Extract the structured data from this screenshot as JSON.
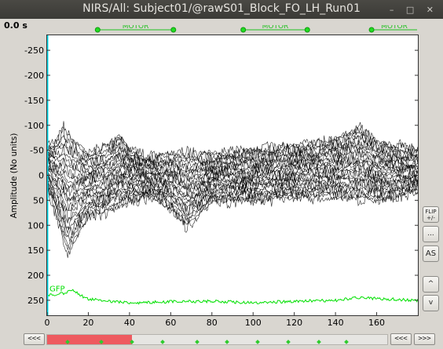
{
  "window": {
    "title": "NIRS/All: Subject01/@rawS01_Block_FO_LH_Run01",
    "min_glyph": "–",
    "max_glyph": "□",
    "close_glyph": "✕"
  },
  "time_label": "0.0 s",
  "events": [
    {
      "label": "MOTOR",
      "start": 24.9,
      "end": 61.7
    },
    {
      "label": "MOTOR",
      "start": 95.6,
      "end": 126.7
    },
    {
      "label": "MOTOR",
      "start": 157.9,
      "end": 180
    }
  ],
  "colors": {
    "signal": "#000000",
    "gfp": "#00e000",
    "events": "#20c020",
    "cursor": "#00d8e8",
    "scroll_thumb": "#ee5a5f"
  },
  "chart_data": {
    "type": "line",
    "ylabel": "Amplitude (No units)",
    "xlim": [
      0,
      180
    ],
    "ylim": [
      -280,
      280
    ],
    "y_inverted": true,
    "xticks": [
      "0",
      "20",
      "40",
      "60",
      "80",
      "100",
      "120",
      "140",
      "160"
    ],
    "yticks": [
      "-250",
      "-200",
      "-150",
      "-100",
      "-50",
      "0",
      "50",
      "100",
      "150",
      "200",
      "250"
    ],
    "series": [
      {
        "name": "GFP",
        "baseline": 248,
        "description_values": [
          [
            0,
            240
          ],
          [
            8,
            236
          ],
          [
            12,
            230
          ],
          [
            20,
            248
          ],
          [
            40,
            255
          ],
          [
            60,
            253
          ],
          [
            80,
            252
          ],
          [
            100,
            255
          ],
          [
            120,
            252
          ],
          [
            140,
            250
          ],
          [
            150,
            245
          ],
          [
            180,
            250
          ]
        ]
      }
    ],
    "envelope_top": [
      [
        0,
        -80
      ],
      [
        5,
        -100
      ],
      [
        8,
        -130
      ],
      [
        12,
        -100
      ],
      [
        20,
        -60
      ],
      [
        30,
        -80
      ],
      [
        35,
        -110
      ],
      [
        40,
        -70
      ],
      [
        50,
        -50
      ],
      [
        60,
        -60
      ],
      [
        80,
        -60
      ],
      [
        100,
        -70
      ],
      [
        120,
        -80
      ],
      [
        140,
        -100
      ],
      [
        152,
        -130
      ],
      [
        160,
        -90
      ],
      [
        170,
        -80
      ],
      [
        180,
        -70
      ]
    ],
    "envelope_bottom": [
      [
        0,
        30
      ],
      [
        5,
        120
      ],
      [
        10,
        215
      ],
      [
        14,
        170
      ],
      [
        20,
        110
      ],
      [
        30,
        100
      ],
      [
        40,
        70
      ],
      [
        50,
        60
      ],
      [
        60,
        90
      ],
      [
        68,
        140
      ],
      [
        80,
        70
      ],
      [
        100,
        70
      ],
      [
        120,
        60
      ],
      [
        140,
        60
      ],
      [
        160,
        70
      ],
      [
        180,
        45
      ]
    ]
  },
  "sidebar": {
    "flip_label": "FLIP +/-",
    "more_label": "...",
    "as_label": "AS",
    "up_label": "^",
    "down_label": "v"
  },
  "scroll": {
    "left_label": "<<<",
    "right_label": "<<<",
    "far_right_label": ">>>",
    "thumb_fraction": 0.25,
    "markers": [
      0.06,
      0.16,
      0.25,
      0.34,
      0.44,
      0.53,
      0.62,
      0.71,
      0.8,
      0.88
    ]
  }
}
